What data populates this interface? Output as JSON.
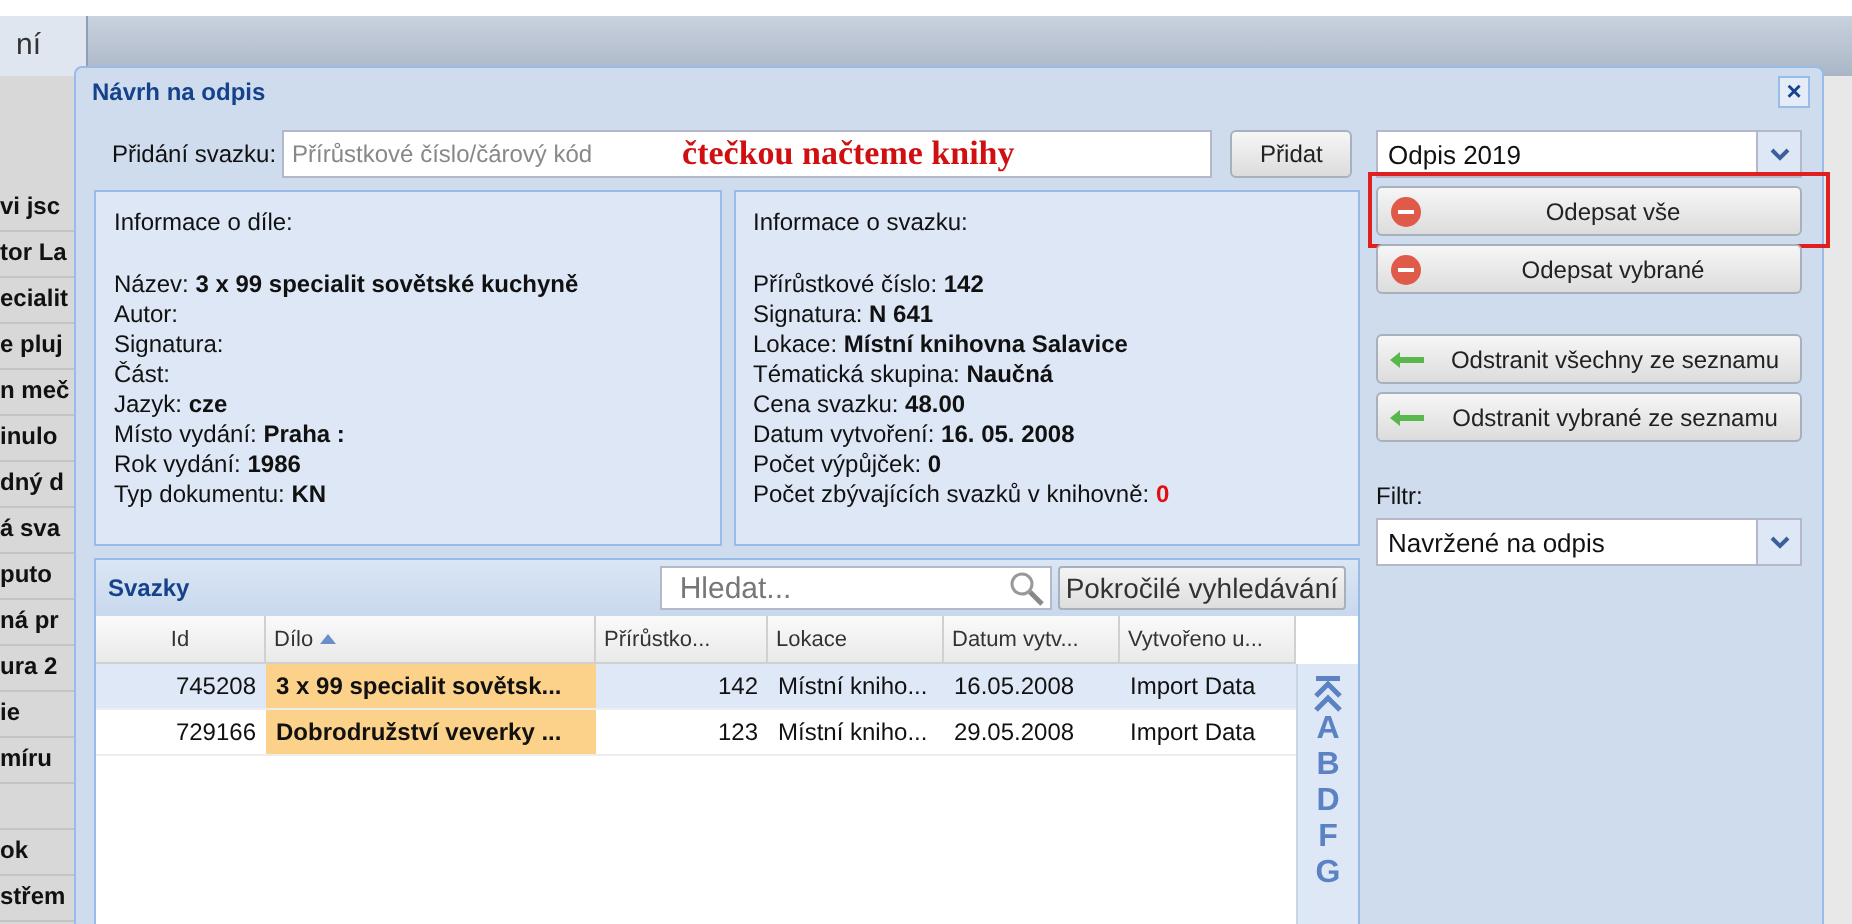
{
  "background": {
    "tab": "ní",
    "rows": [
      "vi jsc",
      "tor La",
      "ecialit",
      "e pluj",
      "n meč",
      "inulo",
      "dný d",
      "á sva",
      "puto",
      "ná pr",
      "ura 2",
      "ie",
      "míru",
      "",
      "ok",
      "střem"
    ]
  },
  "dialog": {
    "title": "Návrh na odpis",
    "close": "×",
    "add": {
      "label": "Přidání svazku:",
      "placeholder": "Přírůstkové číslo/čárový kód",
      "annotation": "čtečkou načteme knihy",
      "button": "Přidat"
    },
    "work_info": {
      "heading": "Informace o díle:",
      "fields": [
        {
          "label": "Název:",
          "value": "3 x 99 specialit sovětské kuchyně"
        },
        {
          "label": "Autor:"
        },
        {
          "label": "Signatura:"
        },
        {
          "label": "Část:"
        },
        {
          "label": "Jazyk:",
          "value": "cze"
        },
        {
          "label": "Místo vydání:",
          "value": "Praha :"
        },
        {
          "label": "Rok vydání:",
          "value": "1986"
        },
        {
          "label": "Typ dokumentu:",
          "value": "KN"
        }
      ]
    },
    "volume_info": {
      "heading": "Informace o svazku:",
      "fields": [
        {
          "label": "Přírůstkové číslo:",
          "value": "142",
          "alert": false
        },
        {
          "label": "Signatura:",
          "value": "N 641",
          "alert": false
        },
        {
          "label": "Lokace:",
          "value": "Místní knihovna Salavice",
          "alert": false
        },
        {
          "label": "Tématická skupina:",
          "value": "Naučná",
          "alert": false
        },
        {
          "label": "Cena svazku:",
          "value": "48.00",
          "alert": false
        },
        {
          "label": "Datum vytvoření:",
          "value": "16. 05. 2008",
          "alert": false
        },
        {
          "label": "Počet výpůjček:",
          "value": "0",
          "alert": false
        },
        {
          "label": "Počet zbývajících svazků v knihovně:",
          "value": "0",
          "alert": true
        }
      ]
    },
    "grid": {
      "title": "Svazky",
      "search_placeholder": "Hledat...",
      "advanced_button": "Pokročilé vyhledávání",
      "columns": [
        {
          "label": "Id",
          "sorted": false
        },
        {
          "label": "Dílo",
          "sorted": true
        },
        {
          "label": "Přírůstko...",
          "sorted": false
        },
        {
          "label": "Lokace",
          "sorted": false
        },
        {
          "label": "Datum vytv...",
          "sorted": false
        },
        {
          "label": "Vytvořeno u...",
          "sorted": false
        }
      ],
      "rows": [
        {
          "selected": true,
          "cells": [
            "745208",
            "3 x 99 specialit sovětsk...",
            "142",
            "Místní kniho...",
            "16.05.2008",
            "Import Data"
          ]
        },
        {
          "selected": false,
          "cells": [
            "729166",
            "Dobrodružství veverky ...",
            "123",
            "Místní kniho...",
            "29.05.2008",
            "Import Data"
          ]
        }
      ],
      "index_letters": [
        "A",
        "B",
        "D",
        "F",
        "G"
      ]
    },
    "side": {
      "list_select": "Odpis 2019",
      "buttons": [
        {
          "label": "Odepsat vše",
          "kind": "remove",
          "highlighted": true
        },
        {
          "label": "Odepsat vybrané",
          "kind": "remove",
          "highlighted": false
        },
        {
          "label": "Odstranit všechny ze seznamu",
          "kind": "back",
          "highlighted": false
        },
        {
          "label": "Odstranit vybrané ze seznamu",
          "kind": "back",
          "highlighted": false
        }
      ],
      "filter_label": "Filtr:",
      "filter_select": "Navržené na odpis"
    }
  }
}
